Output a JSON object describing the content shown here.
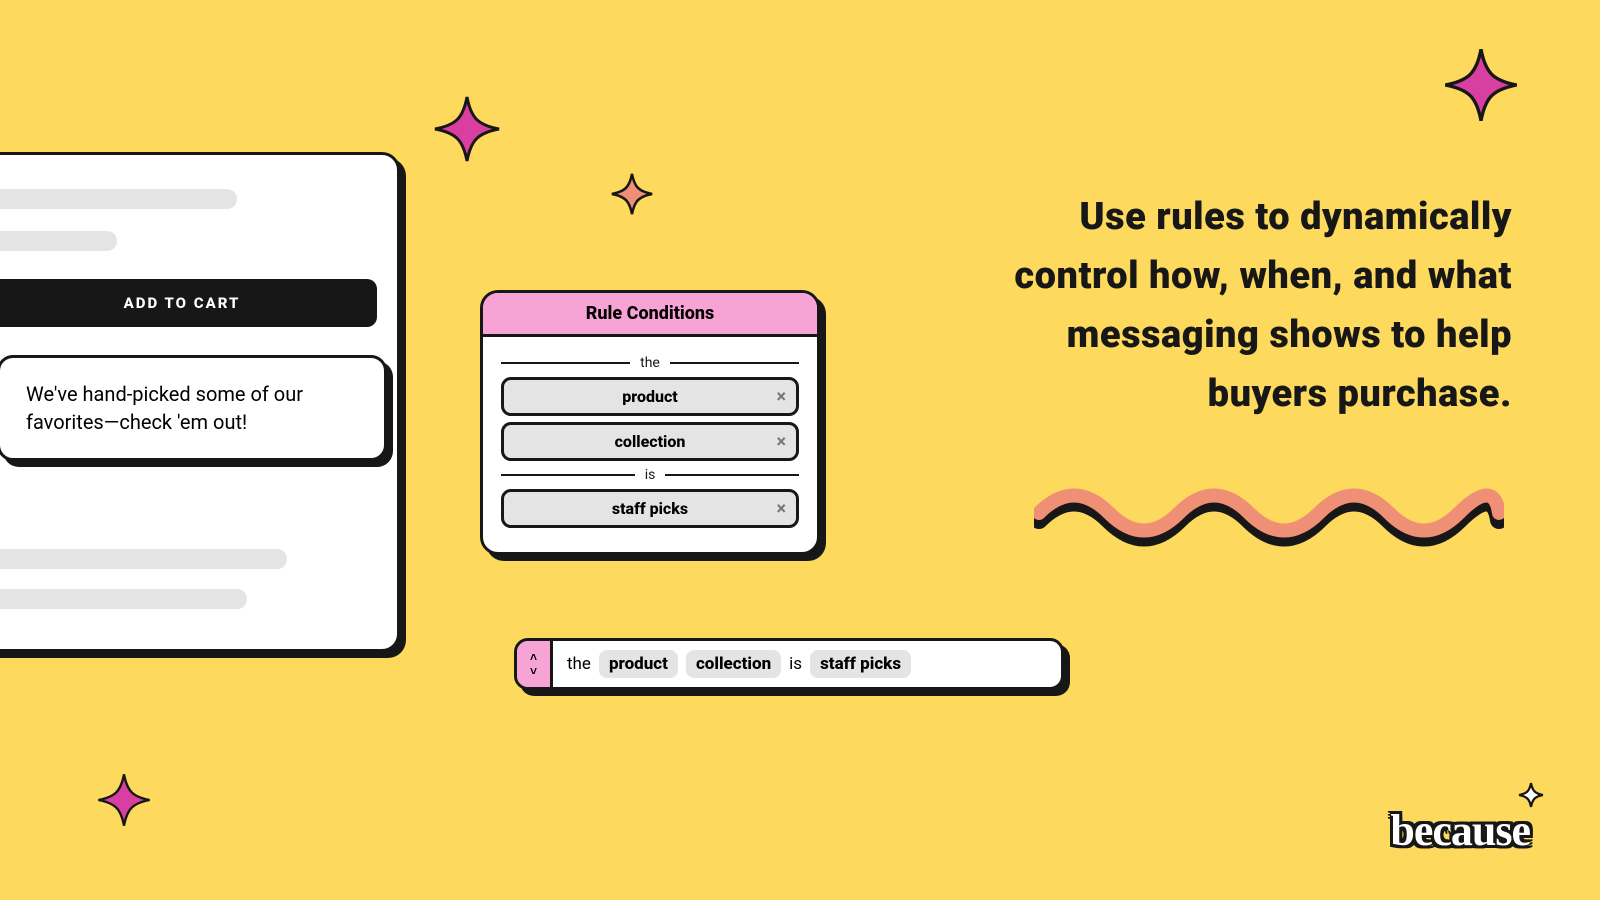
{
  "product": {
    "add_to_cart": "ADD TO CART",
    "message": "We've hand-picked some of our favorites—check 'em out!"
  },
  "rules_panel": {
    "title": "Rule Conditions",
    "pre": "the",
    "chips": [
      "product",
      "collection"
    ],
    "mid": "is",
    "value_chip": "staff picks"
  },
  "rule_bar": {
    "pre": "the",
    "chip1": "product",
    "chip2": "collection",
    "mid": "is",
    "chip3": "staff picks"
  },
  "headline": "Use rules to dynamically control how, when, and what messaging shows to help buyers purchase.",
  "logo": "because",
  "colors": {
    "bg": "#fdd95e",
    "ink": "#171717",
    "pink": "#f7a3d6",
    "magenta": "#d83fa0",
    "coral": "#ef8f75"
  }
}
